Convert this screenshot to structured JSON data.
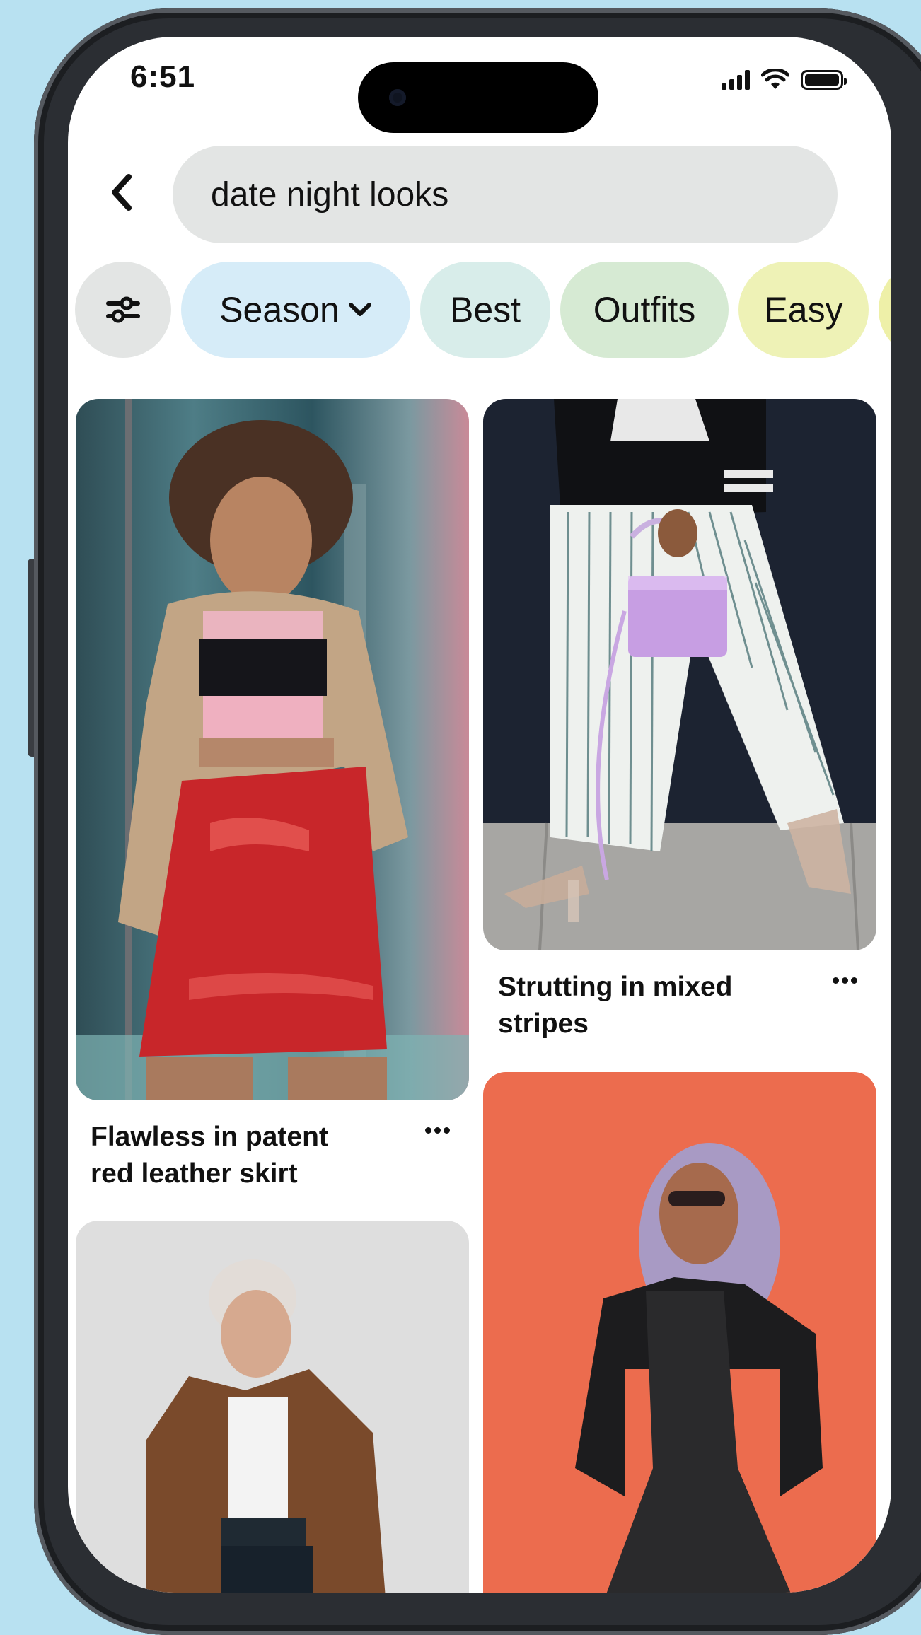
{
  "status_bar": {
    "time": "6:51"
  },
  "search": {
    "query": "date night looks"
  },
  "filters": {
    "filter_icon": "sliders-icon",
    "chips": [
      {
        "label": "Season",
        "color": "#d6ecf8",
        "has_dropdown": true
      },
      {
        "label": "Best",
        "color": "#d8edea"
      },
      {
        "label": "Outfits",
        "color": "#d6ead3"
      },
      {
        "label": "Easy",
        "color": "#eef2b6"
      },
      {
        "label": "",
        "color": "#eef0a8"
      }
    ]
  },
  "pins": [
    {
      "title": "Flawless in patent red leather skirt"
    },
    {
      "title": "Strutting in mixed stripes"
    },
    {
      "title": ""
    },
    {
      "title": ""
    }
  ],
  "colors": {
    "page_background": "#b8e1f1",
    "search_background": "#e3e5e4",
    "text": "#111111"
  }
}
